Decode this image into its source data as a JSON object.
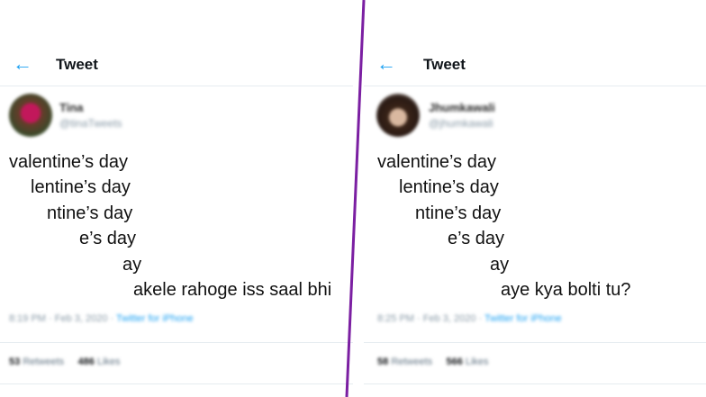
{
  "left": {
    "header": {
      "back_icon": "back-arrow-icon",
      "title": "Tweet"
    },
    "user": {
      "name": "Tina",
      "handle": "@tinaTweets"
    },
    "lines": [
      "valentine’s day",
      "lentine’s day",
      "ntine’s day",
      "e’s day",
      "ay",
      "akele rahoge iss saal bhi"
    ],
    "meta": {
      "time": "8:19 PM · Feb 3, 2020 · ",
      "source": "Twitter for iPhone"
    },
    "stats": {
      "retweets_count": "53",
      "retweets_label": "Retweets",
      "likes_count": "486",
      "likes_label": "Likes"
    }
  },
  "right": {
    "header": {
      "back_icon": "back-arrow-icon",
      "title": "Tweet"
    },
    "user": {
      "name": "Jhumkawali",
      "handle": "@jhumkawali"
    },
    "lines": [
      "valentine’s day",
      "lentine’s day",
      "ntine’s day",
      "e’s day",
      "ay",
      "aye kya bolti tu?"
    ],
    "meta": {
      "time": "8:25 PM · Feb 3, 2020 · ",
      "source": "Twitter for iPhone"
    },
    "stats": {
      "retweets_count": "58",
      "retweets_label": "Retweets",
      "likes_count": "566",
      "likes_label": "Likes"
    }
  },
  "colors": {
    "accent": "#1da1f2",
    "separator": "#7b1fa2"
  }
}
